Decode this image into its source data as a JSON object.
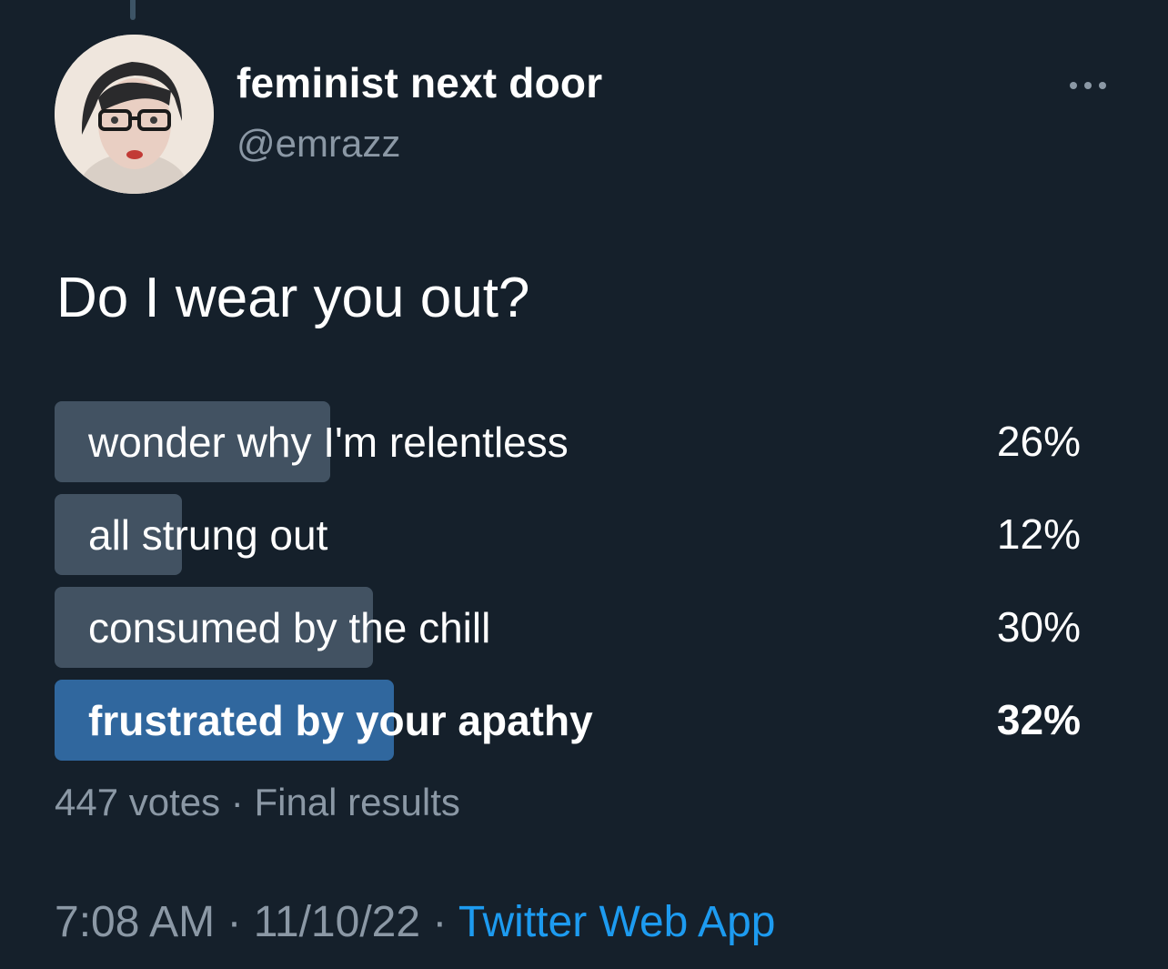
{
  "author": {
    "display_name": "feminist next door",
    "handle": "@emrazz",
    "avatar_icon": "profile-photo"
  },
  "menu": {
    "icon": "more-options-icon"
  },
  "tweet": {
    "text": "Do I wear you out?"
  },
  "poll": {
    "options": [
      {
        "label": "wonder why I'm relentless",
        "percent": "26%",
        "fraction": 0.26,
        "winner": false
      },
      {
        "label": "all strung out",
        "percent": "12%",
        "fraction": 0.12,
        "winner": false
      },
      {
        "label": "consumed by the chill",
        "percent": "30%",
        "fraction": 0.3,
        "winner": false
      },
      {
        "label": "frustrated by your apathy",
        "percent": "32%",
        "fraction": 0.32,
        "winner": true
      }
    ],
    "votes": "447 votes",
    "separator": " · ",
    "status": "Final results"
  },
  "meta": {
    "time": "7:08 AM",
    "date": "11/10/22",
    "separator": " · ",
    "source": "Twitter Web App"
  },
  "colors": {
    "background": "#15202b",
    "bar": "#425262",
    "winner_bar": "#30679e",
    "secondary_text": "#8b98a5",
    "link": "#1d9bf0"
  }
}
